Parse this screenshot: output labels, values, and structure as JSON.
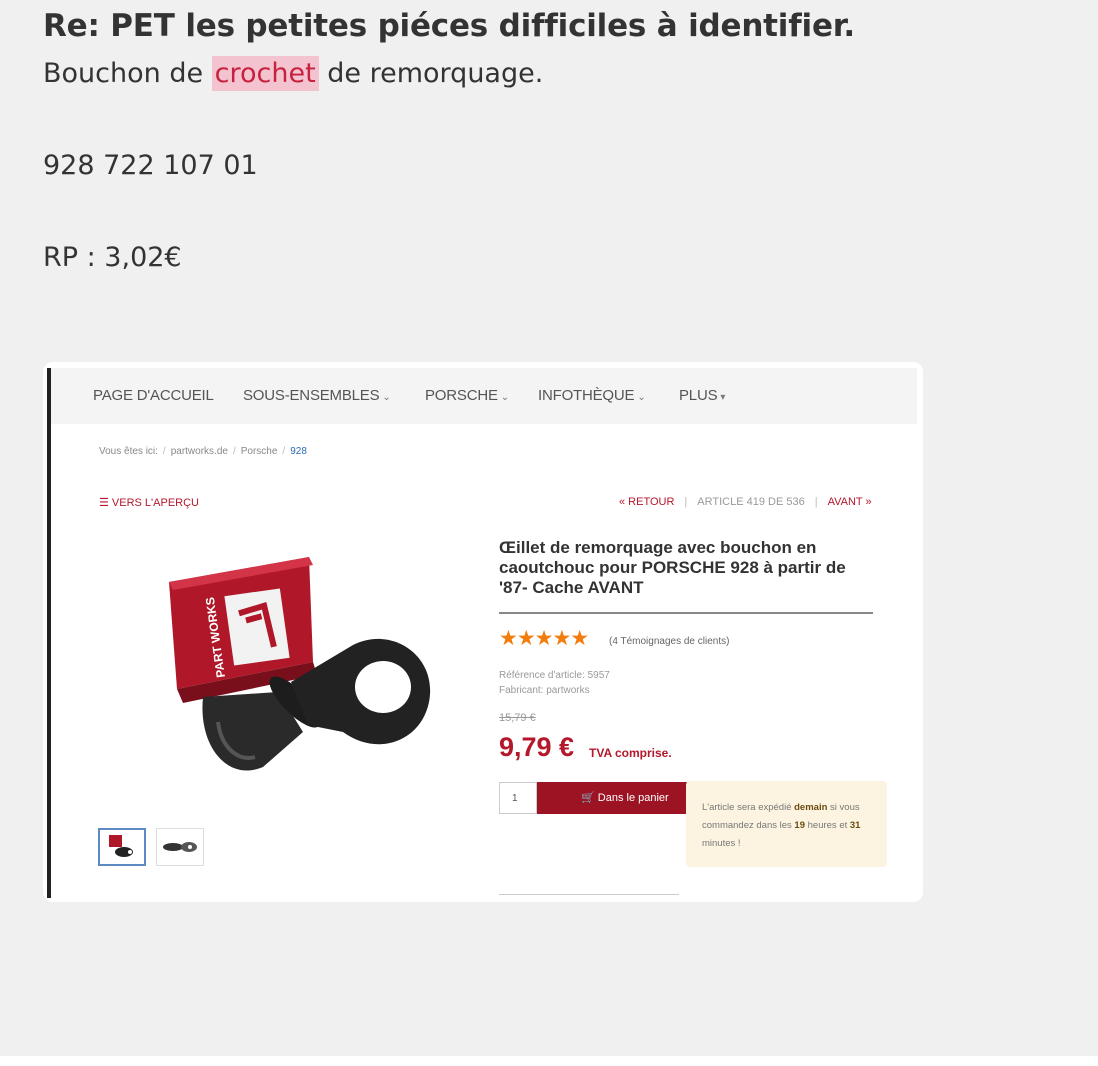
{
  "post": {
    "title": "Re: PET les petites piéces difficiles à identifier.",
    "line1_before": "Bouchon de ",
    "line1_highlight": "crochet",
    "line1_after": " de remorquage.",
    "part_number": "928 722 107 01",
    "price": "RP : 3,02€"
  },
  "screenshot": {
    "nav": [
      {
        "label": "PAGE D'ACCUEIL",
        "caret": ""
      },
      {
        "label": "SOUS-ENSEMBLES",
        "caret": "⌄"
      },
      {
        "label": "PORSCHE",
        "caret": "⌄"
      },
      {
        "label": "INFOTHÈQUE",
        "caret": "⌄"
      },
      {
        "label": "PLUS",
        "caret": "▾"
      }
    ],
    "breadcrumb": [
      "Vous êtes ici:",
      "partworks.de",
      "Porsche",
      "928"
    ],
    "back_overview": "☰ VERS L'APERÇU",
    "pager": {
      "back": "« RETOUR",
      "article": "ARTICLE 419 DE 536",
      "next": "AVANT »"
    },
    "product": {
      "title": "Œillet de remorquage avec bouchon en caoutchouc pour PORSCHE 928 à partir de '87- Cache AVANT",
      "stars": "★★★★★",
      "rating": 5,
      "reviews": "(4 Témoignages de clients)",
      "reference": "Référence d'article: 5957",
      "manufacturer": "Fabricant: partworks",
      "old_price": "15,79 €",
      "price": "9,79 €",
      "vat": "TVA comprise.",
      "qty": "1",
      "cart_label": "Dans le panier",
      "box_logo": "PART WORKS"
    },
    "shipping": {
      "before": "L'article sera expédié ",
      "when": "demain",
      "mid1": " si vous commandez dans les ",
      "hours": "19",
      "mid2": " heures et ",
      "minutes": "31",
      "after": " minutes !"
    }
  },
  "colors": {
    "accent_red": "#b5172b",
    "button_red": "#9c1424",
    "star_orange": "#f27d0c",
    "highlight_bg": "#f3c4cf"
  }
}
